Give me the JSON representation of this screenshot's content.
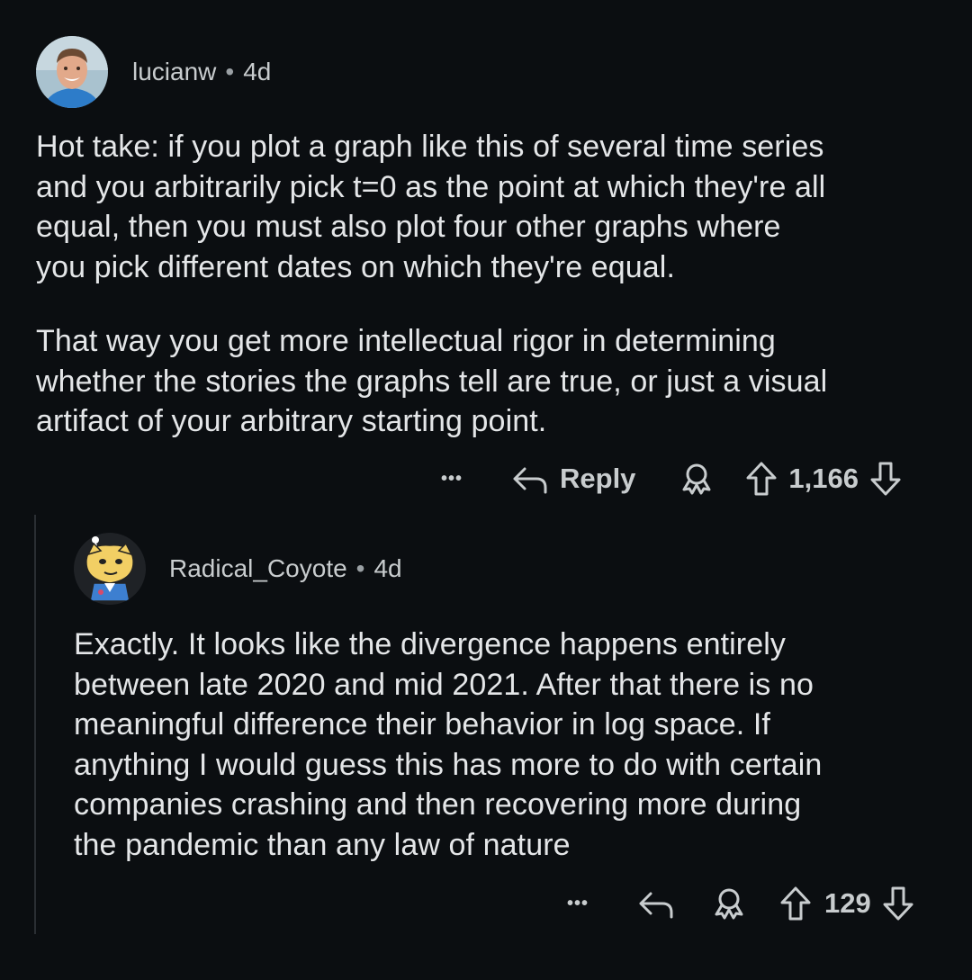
{
  "comments": [
    {
      "username": "lucianw",
      "separator": "•",
      "age": "4d",
      "paragraphs": [
        [
          "Hot take: if you plot a graph like this of several time series",
          "and you arbitrarily pick t=0 as the point at which they're all",
          "equal, then you must also plot four other graphs where",
          "you pick different dates on which they're equal."
        ],
        [
          "That way you get more intellectual rigor in determining",
          "whether the stories the graphs tell are true, or just a visual",
          "artifact of your arbitrary starting point."
        ]
      ],
      "actions": {
        "more_label": "•••",
        "reply_label": "Reply",
        "score": "1,166"
      }
    },
    {
      "username": "Radical_Coyote",
      "separator": "•",
      "age": "4d",
      "paragraphs": [
        [
          "Exactly. It looks like the divergence happens entirely",
          "between late 2020 and mid 2021. After that there is no",
          "meaningful difference their behavior in log space. If",
          "anything I would guess this has more to do with certain",
          "companies crashing and then recovering more during",
          "the pandemic than any law of nature"
        ]
      ],
      "actions": {
        "more_label": "•••",
        "score": "129"
      }
    }
  ],
  "icons": {
    "reply": "reply-arrow-icon",
    "award": "award-icon",
    "upvote": "upvote-arrow-icon",
    "downvote": "downvote-arrow-icon"
  }
}
